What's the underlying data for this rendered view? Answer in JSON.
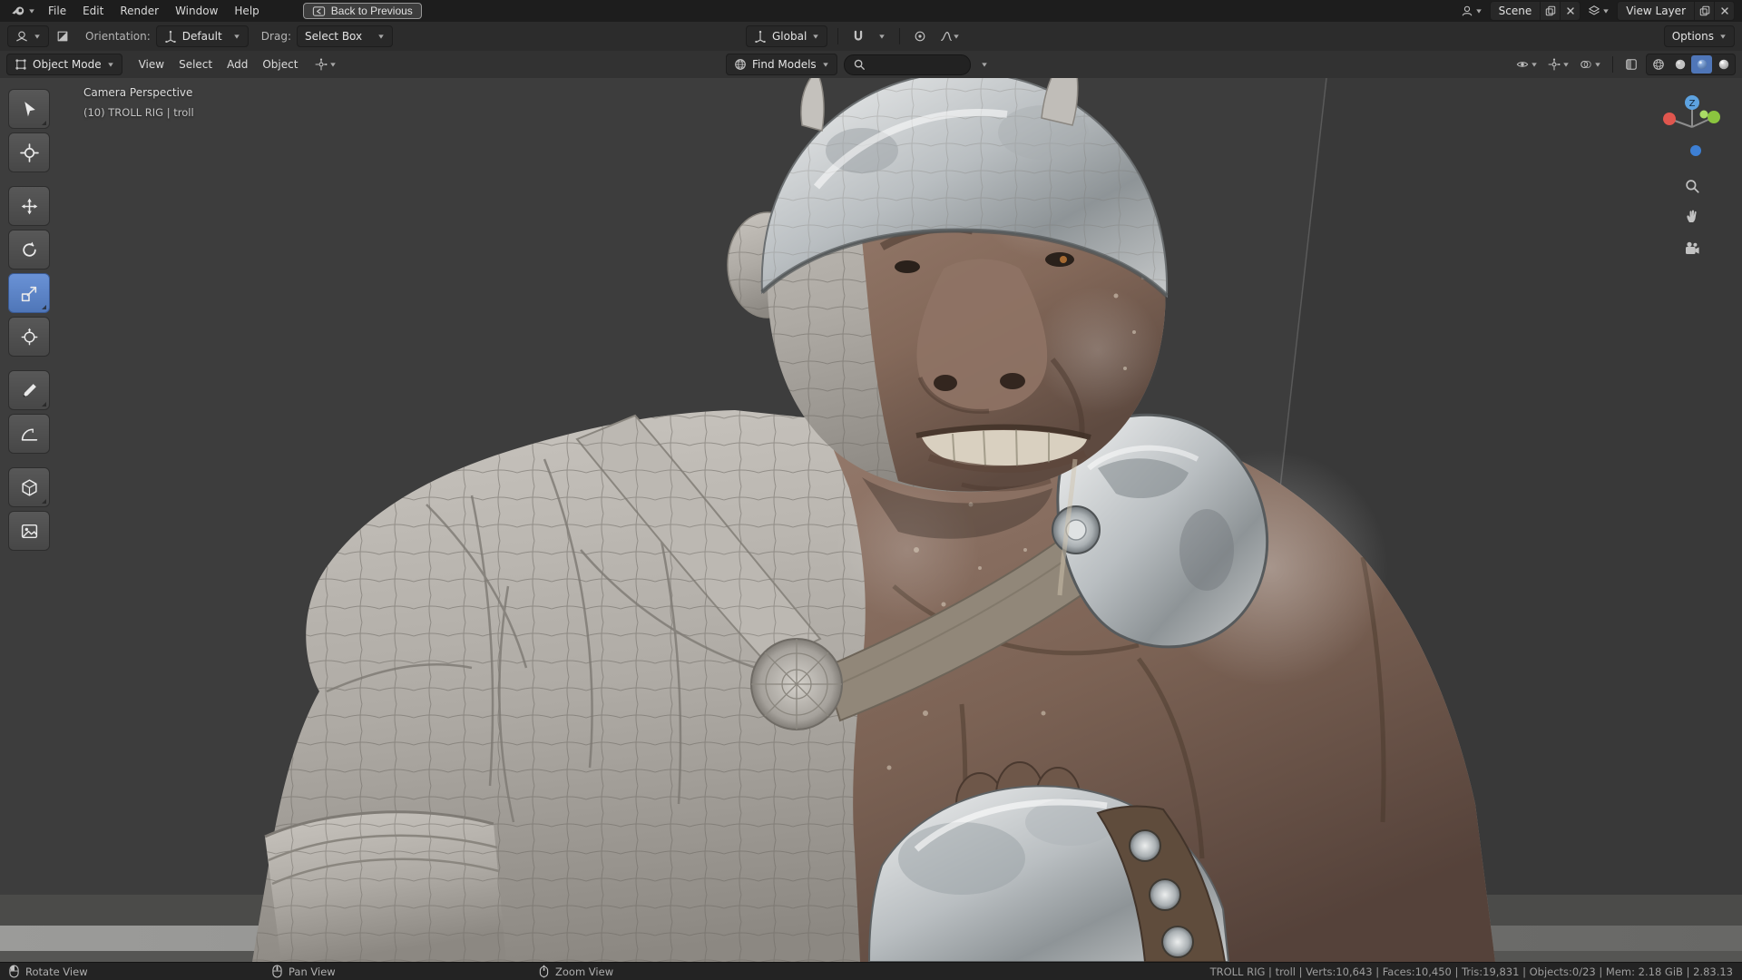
{
  "menubar": {
    "menus": [
      "File",
      "Edit",
      "Render",
      "Window",
      "Help"
    ],
    "back_button": "Back to Previous",
    "scene_selector": {
      "label": "Scene"
    },
    "view_layer_selector": {
      "label": "View Layer"
    }
  },
  "tool_settings": {
    "orientation_label": "Orientation:",
    "orientation_value": "Default",
    "drag_label": "Drag:",
    "drag_value": "Select Box",
    "transform_orientation": "Global",
    "options_button": "Options"
  },
  "viewport_header": {
    "mode": "Object Mode",
    "menus": [
      "View",
      "Select",
      "Add",
      "Object"
    ],
    "find_models_label": "Find Models"
  },
  "tools": {
    "items": [
      "select-box",
      "cursor",
      "move",
      "rotate",
      "scale",
      "transform",
      "annotate",
      "measure",
      "add-cube",
      "texture"
    ],
    "active": "scale"
  },
  "viewport": {
    "overlay_line1": "Camera Perspective",
    "overlay_line2": "(10) TROLL RIG | troll",
    "axis_label_z": "Z"
  },
  "statusbar": {
    "hints": [
      {
        "icon": "mouse-left-drag",
        "label": "Rotate View"
      },
      {
        "icon": "mouse-middle-drag",
        "label": "Pan View"
      },
      {
        "icon": "mouse-scroll",
        "label": "Zoom View"
      }
    ],
    "info": "TROLL RIG | troll | Verts:10,643 | Faces:10,450 | Tris:19,831 | Objects:0/23 | Mem: 2.18 GiB | 2.83.13"
  },
  "colors": {
    "accent": "#4f76b8",
    "viewport_bg": "#3d3d3d",
    "clay": "#b5b1ab",
    "skin": "#7a6254"
  }
}
